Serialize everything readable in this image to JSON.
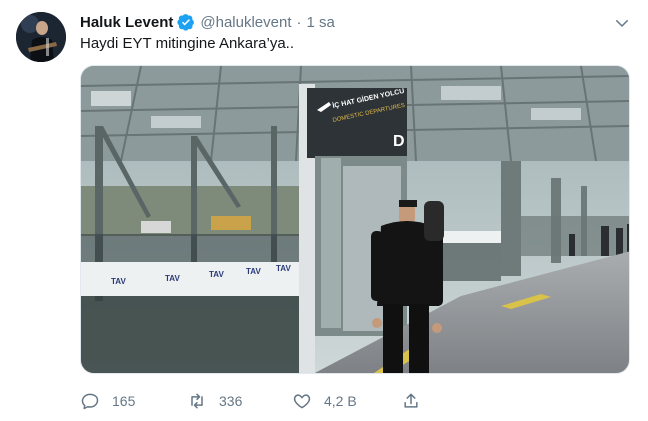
{
  "tweet": {
    "author_name": "Haluk Levent",
    "handle": "@haluklevent",
    "separator": "·",
    "time": "1 sa",
    "text": "Haydi EYT mitingine Ankara’ya..",
    "photo": {
      "sign_text": "İÇ HAT GİDEN YOLCU",
      "sign_subtext": "DOMESTIC DEPARTURES",
      "sign_letter": "D",
      "banner_text": [
        "TAV",
        "TAV",
        "TAV",
        "TAV",
        "TAV"
      ]
    },
    "actions": {
      "replies": "165",
      "retweets": "336",
      "likes": "4,2 B"
    }
  },
  "colors": {
    "text": "#14171a",
    "secondary": "#657786",
    "verified": "#1da1f2",
    "border": "#e1e8ed"
  },
  "icons": [
    "verified-badge-icon",
    "chevron-down-icon",
    "reply-icon",
    "retweet-icon",
    "like-icon",
    "share-icon"
  ]
}
